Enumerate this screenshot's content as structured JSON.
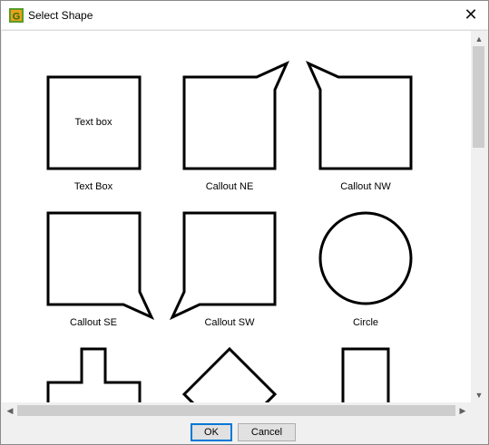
{
  "window": {
    "title": "Select Shape",
    "close_symbol": "✕"
  },
  "shapes": [
    {
      "label": "Text Box",
      "inner_text": "Text box",
      "icon": "text-box-shape"
    },
    {
      "label": "Callout NE",
      "icon": "callout-ne-shape"
    },
    {
      "label": "Callout NW",
      "icon": "callout-nw-shape"
    },
    {
      "label": "Callout SE",
      "icon": "callout-se-shape"
    },
    {
      "label": "Callout SW",
      "icon": "callout-sw-shape"
    },
    {
      "label": "Circle",
      "icon": "circle-shape"
    }
  ],
  "partial_shapes": [
    {
      "icon": "cross-shape"
    },
    {
      "icon": "diamond-shape"
    },
    {
      "icon": "rectangle-shape"
    }
  ],
  "scrollbars": {
    "up_arrow": "▲",
    "down_arrow": "▼",
    "left_arrow": "◀",
    "right_arrow": "▶"
  },
  "buttons": {
    "ok": "OK",
    "cancel": "Cancel"
  },
  "colors": {
    "icon_green": "#5a9b2a",
    "icon_orange": "#e8a317",
    "accent": "#0078d7"
  }
}
